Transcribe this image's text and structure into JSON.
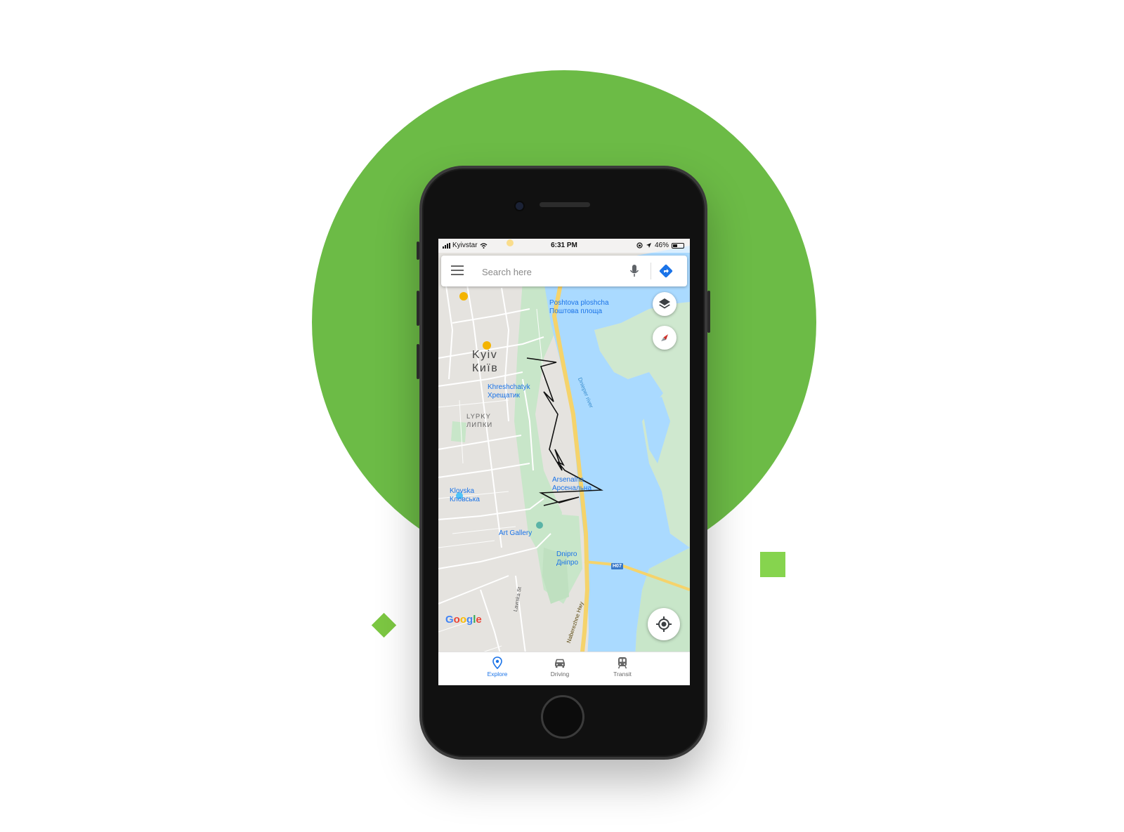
{
  "status_bar": {
    "carrier": "Kyivstar",
    "time": "6:31 PM",
    "battery": "46%",
    "battery_level": 0.46
  },
  "search": {
    "placeholder": "Search here"
  },
  "map": {
    "labels": {
      "poshtova_en": "Poshtova ploshcha",
      "poshtova_uk": "Поштова площа",
      "kyiv_en": "Kyiv",
      "kyiv_uk": "Київ",
      "khreshchatyk_en": "Khreshchatyk",
      "khreshchatyk_uk": "Хрещатик",
      "lypky_en": "LYPKY",
      "lypky_uk": "ЛИПКИ",
      "arsenalna_en": "Arsenalna",
      "arsenalna_uk": "Арсенальна",
      "klovska_en": "Klovska",
      "klovska_uk": "Кловська",
      "art_gallery": "Art Gallery",
      "dnipro_en": "Dnipro",
      "dnipro_uk": "Дніпро",
      "dnieper_river": "Dnieper river",
      "naberezhne_hwy": "Naberezhne Hwy",
      "lavrska_st": "Lavrska St",
      "h07": "H07"
    },
    "attribution": "Google",
    "colors": {
      "land": "#e5e3df",
      "park": "#c8e6c9",
      "water": "#aadaff",
      "highway": "#f5d36b",
      "road": "#ffffff"
    }
  },
  "bottom_nav": {
    "items": [
      {
        "label": "Explore",
        "icon": "map-pin-icon",
        "active": true
      },
      {
        "label": "Driving",
        "icon": "car-icon",
        "active": false
      },
      {
        "label": "Transit",
        "icon": "train-icon",
        "active": false
      }
    ]
  },
  "decor": {
    "circle_color": "#6cbb46",
    "square_color": "#86d44e",
    "diamond_color": "#7cc742"
  }
}
